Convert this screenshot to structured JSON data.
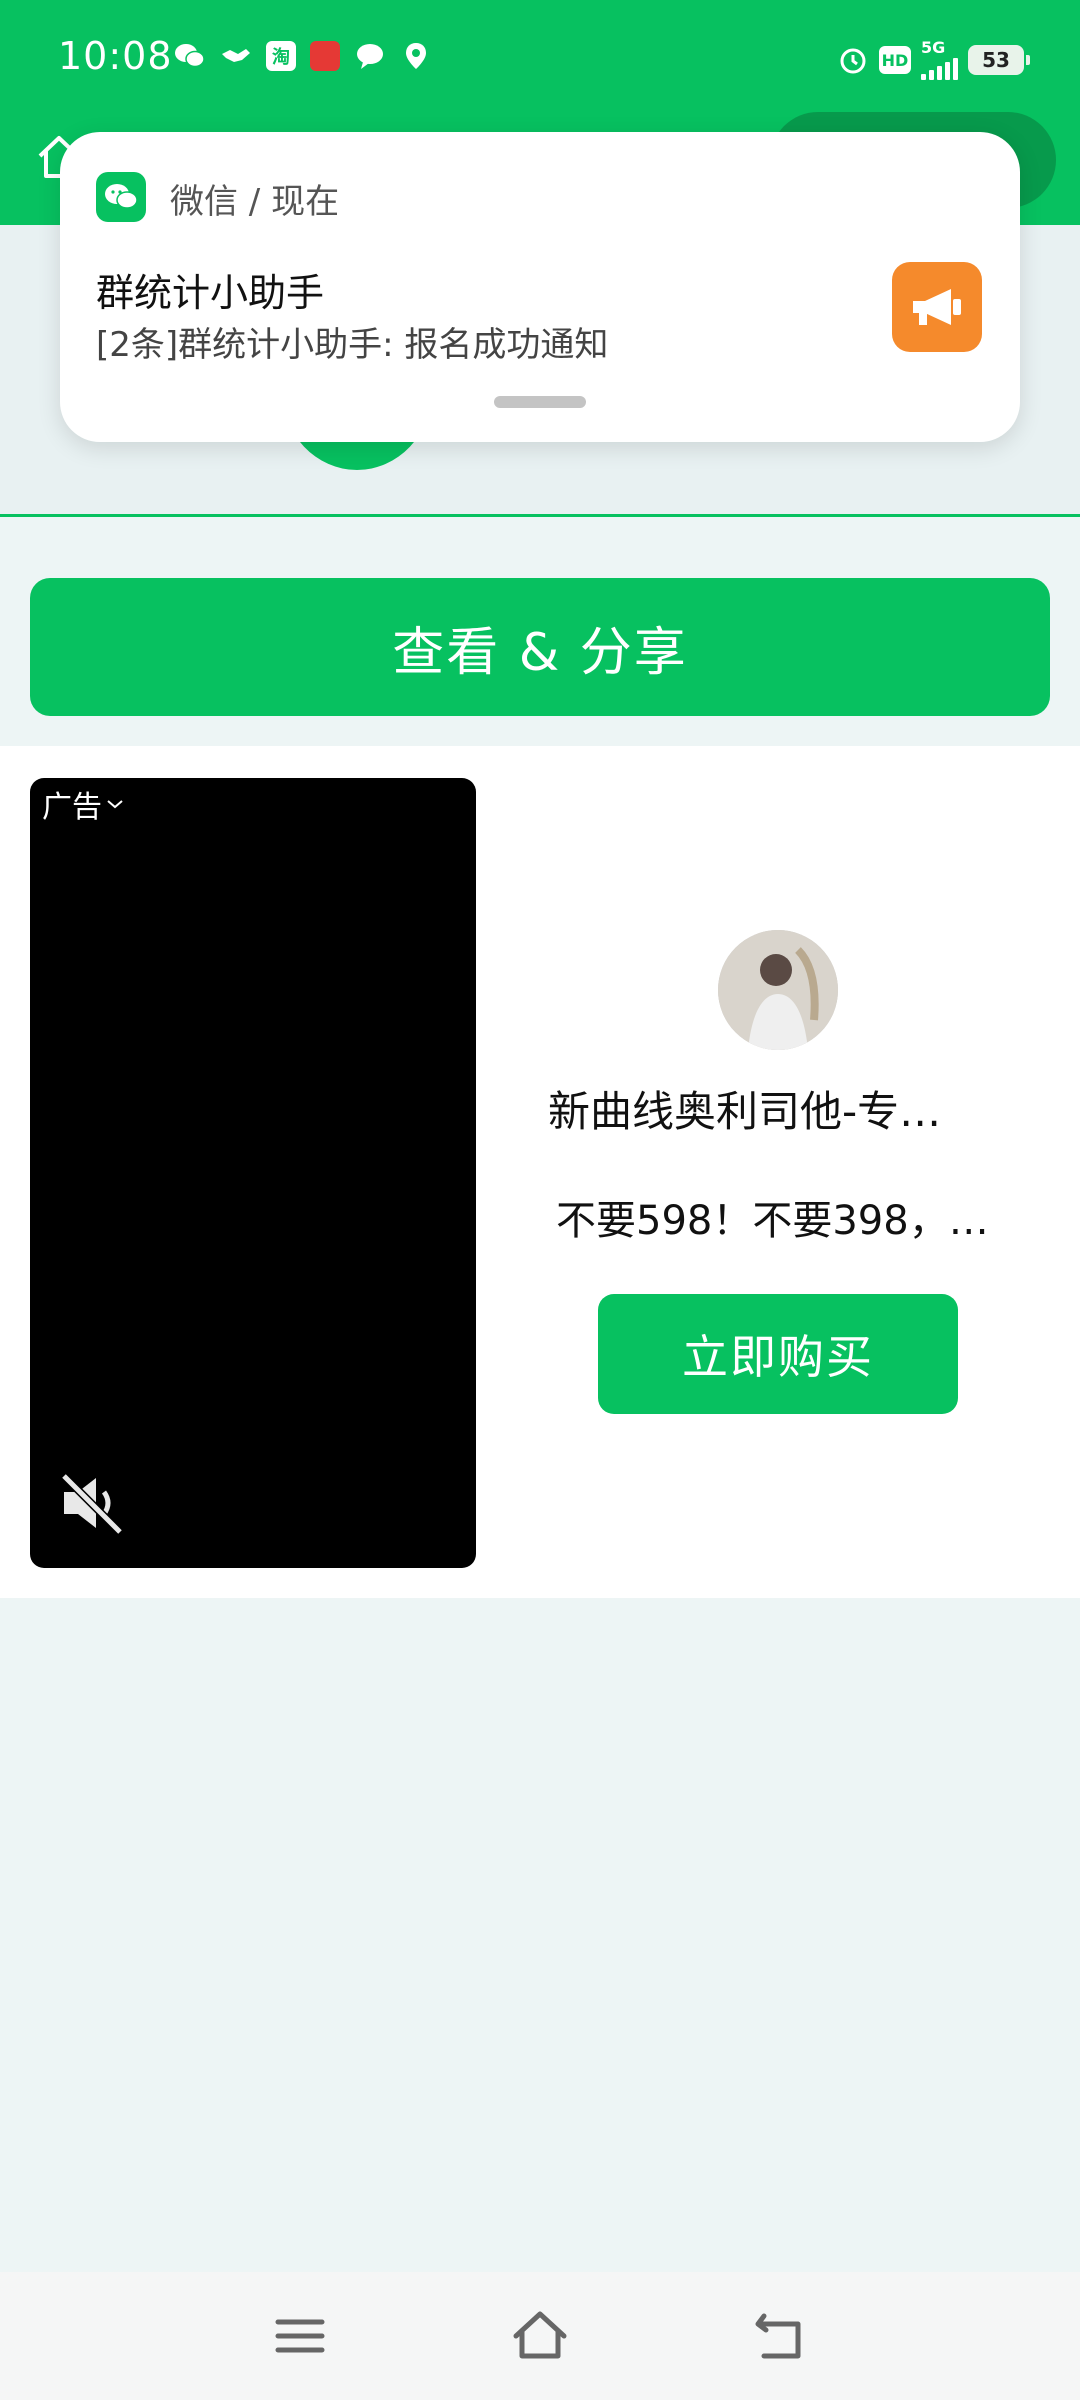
{
  "status_bar": {
    "time": "10:08",
    "notification_icons": [
      "wechat-icon",
      "handshake-icon",
      "taobao-icon",
      "pinduoduo-icon",
      "message-icon",
      "baidu-maps-icon"
    ],
    "taobao_glyph": "淘",
    "hd_label": "HD",
    "network_label": "5G",
    "battery": "53"
  },
  "header": {
    "home_icon": "home-icon"
  },
  "notification": {
    "app_label": "微信 / 现在",
    "title": "群统计小助手",
    "body": "[2条]群统计小助手: 报名成功通知",
    "thumb_icon": "megaphone-icon"
  },
  "actions": {
    "share_label": "查看 & 分享"
  },
  "ad": {
    "tag": "广告",
    "seller_name": "新曲线奥利司他-专…",
    "description": "不要598！不要398，…",
    "buy_label": "立即购买",
    "mute_icon": "volume-mute-icon"
  },
  "nav": {
    "items": [
      "menu-icon",
      "home-icon",
      "back-icon"
    ]
  },
  "colors": {
    "brand_green": "#07c160",
    "notification_orange": "#f58a2c"
  }
}
